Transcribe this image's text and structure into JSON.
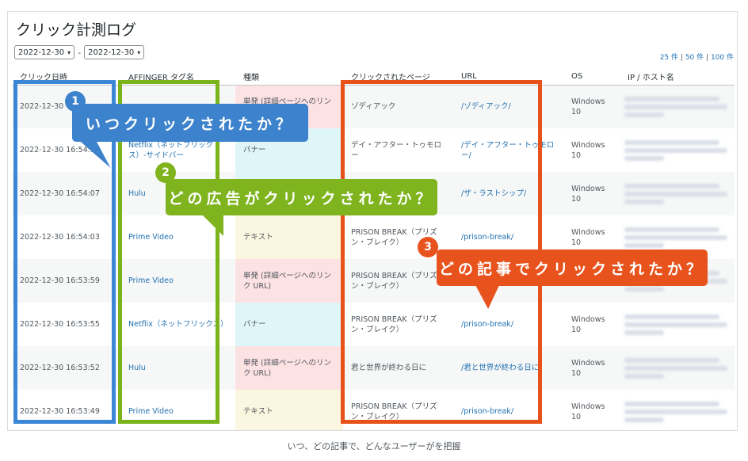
{
  "page": {
    "title": "クリック計測ログ"
  },
  "filters": {
    "date_from": "2022-12-30",
    "date_to": "2022-12-30",
    "separator": "-"
  },
  "pager": {
    "opt1": "25 件",
    "opt2": "50 件",
    "opt3": "100 件",
    "sep": "|"
  },
  "table": {
    "columns": [
      "クリック日時",
      "AFFINGER タグ名",
      "種類",
      "クリックされたページ",
      "URL",
      "OS",
      "IP / ホスト名"
    ],
    "rows": [
      {
        "date": "2022-12-30",
        "tag": "",
        "type": "単発 (詳細ページへのリンク",
        "page": "ゾディアック",
        "url": "/ゾディアック/",
        "os": "Windows 10"
      },
      {
        "date": "2022-12-30 16:54:10",
        "tag": "Netflix（ネットフリックス）-サイドバー",
        "type": "バナー",
        "page": "デイ・アフター・トゥモロー",
        "url": "/デイ・アフター・トゥモロー/",
        "os": "Windows 10"
      },
      {
        "date": "2022-12-30 16:54:07",
        "tag": "Hulu",
        "type": "",
        "page": "",
        "url": "/ザ・ラストシップ/",
        "os": "Windows 10"
      },
      {
        "date": "2022-12-30 16:54:03",
        "tag": "Prime Video",
        "type": "テキスト",
        "page": "PRISON BREAK（プリズン・ブレイク）",
        "url": "/prison-break/",
        "os": "Windows 10"
      },
      {
        "date": "2022-12-30 16:53:59",
        "tag": "Prime Video",
        "type": "単発 (詳細ページへのリンク URL)",
        "page": "PRISON BREAK（プリズン・ブレイク）",
        "url": "",
        "os": ""
      },
      {
        "date": "2022-12-30 16:53:55",
        "tag": "Netflix（ネットフリックス）",
        "type": "バナー",
        "page": "PRISON BREAK（プリズン・ブレイク）",
        "url": "/prison-break/",
        "os": "Windows 10"
      },
      {
        "date": "2022-12-30 16:53:52",
        "tag": "Hulu",
        "type": "単発 (詳細ページへのリンク URL)",
        "page": "君と世界が終わる日に",
        "url": "/君と世界が終わる日に",
        "os": "Windows 10"
      },
      {
        "date": "2022-12-30 16:53:49",
        "tag": "Prime Video",
        "type": "テキスト",
        "page": "PRISON BREAK（プリズン・ブレイク）",
        "url": "/prison-break/",
        "os": "Windows 10"
      }
    ]
  },
  "annotations": {
    "when": {
      "number": "1",
      "text": "いつクリックされたか？"
    },
    "which_ad": {
      "number": "2",
      "text": "どの広告がクリックされたか？"
    },
    "which_article": {
      "number": "3",
      "text": "どの記事でクリックされたか？"
    }
  },
  "caption": "いつ、どの記事で、どんなユーザーがを把握",
  "colors": {
    "blue": "#3d82cc",
    "green": "#7fb41f",
    "orange": "#e8531d",
    "link": "#2271b1"
  }
}
